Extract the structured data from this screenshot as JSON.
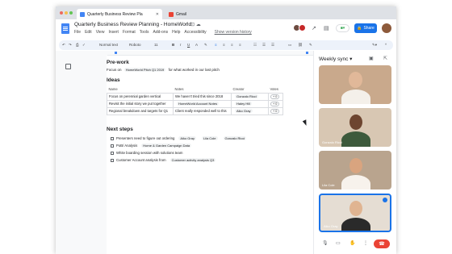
{
  "browser": {
    "active_tab": "Quarterly Business Review Pla",
    "other_tab": "Gmail"
  },
  "doc": {
    "title": "Quarterly Business Review Planning - HomeWorld",
    "menus": [
      "File",
      "Edit",
      "View",
      "Insert",
      "Format",
      "Tools",
      "Add-ons",
      "Help",
      "Accessibility"
    ],
    "history_link": "Show version history",
    "share_label": "Share",
    "toolbar": {
      "style": "Normal text",
      "font": "Roboto",
      "size": "11"
    }
  },
  "content": {
    "preswork_heading": "Pre-work",
    "preswork_text_a": "Focus on",
    "preswork_chip": "HomeWorld Pitch Q1 2019",
    "preswork_text_b": "for what worked in our last pitch",
    "ideas_heading": "Ideas",
    "ideas_table": {
      "headers": [
        "Name",
        "Notes",
        "Creator",
        "Votes"
      ],
      "rows": [
        [
          "Focus on perennial garden vertical",
          "We haven't tried this since 2018",
          "Gonzalo Ricci",
          "+ 0"
        ],
        [
          "Revisit the initial story we put together",
          "HomeWorld Account Notes",
          "Haley Hill",
          "+ 0"
        ],
        [
          "Regional breakdown and targets for Q1",
          "Client really responded well to this",
          "Aiko Gray",
          "+ 0"
        ]
      ]
    },
    "next_heading": "Next steps",
    "tasks": [
      {
        "text": "Presenters need to figure out ordering",
        "chips": [
          "Aiko Gray",
          "Lila Cole",
          "Gonzalo Ricci"
        ]
      },
      {
        "text": "PoB/ Analysis",
        "chips": [
          "Home & Garden Campaign Data"
        ]
      },
      {
        "text": "White boarding session with solutions team",
        "chips": []
      },
      {
        "text": "Customer Account analysis from",
        "chips": [
          "Customer activity analysis Q3"
        ]
      }
    ]
  },
  "meet": {
    "title": "Weekly sync",
    "tiles": [
      {
        "name": "",
        "bg": "#c9a98c"
      },
      {
        "name": "Gonzalo Ricci",
        "bg": "#d8c7b3"
      },
      {
        "name": "Lila Cole",
        "bg": "#b9a48e"
      },
      {
        "name": "Aiko Gray",
        "bg": "#e5ddd3"
      }
    ]
  }
}
